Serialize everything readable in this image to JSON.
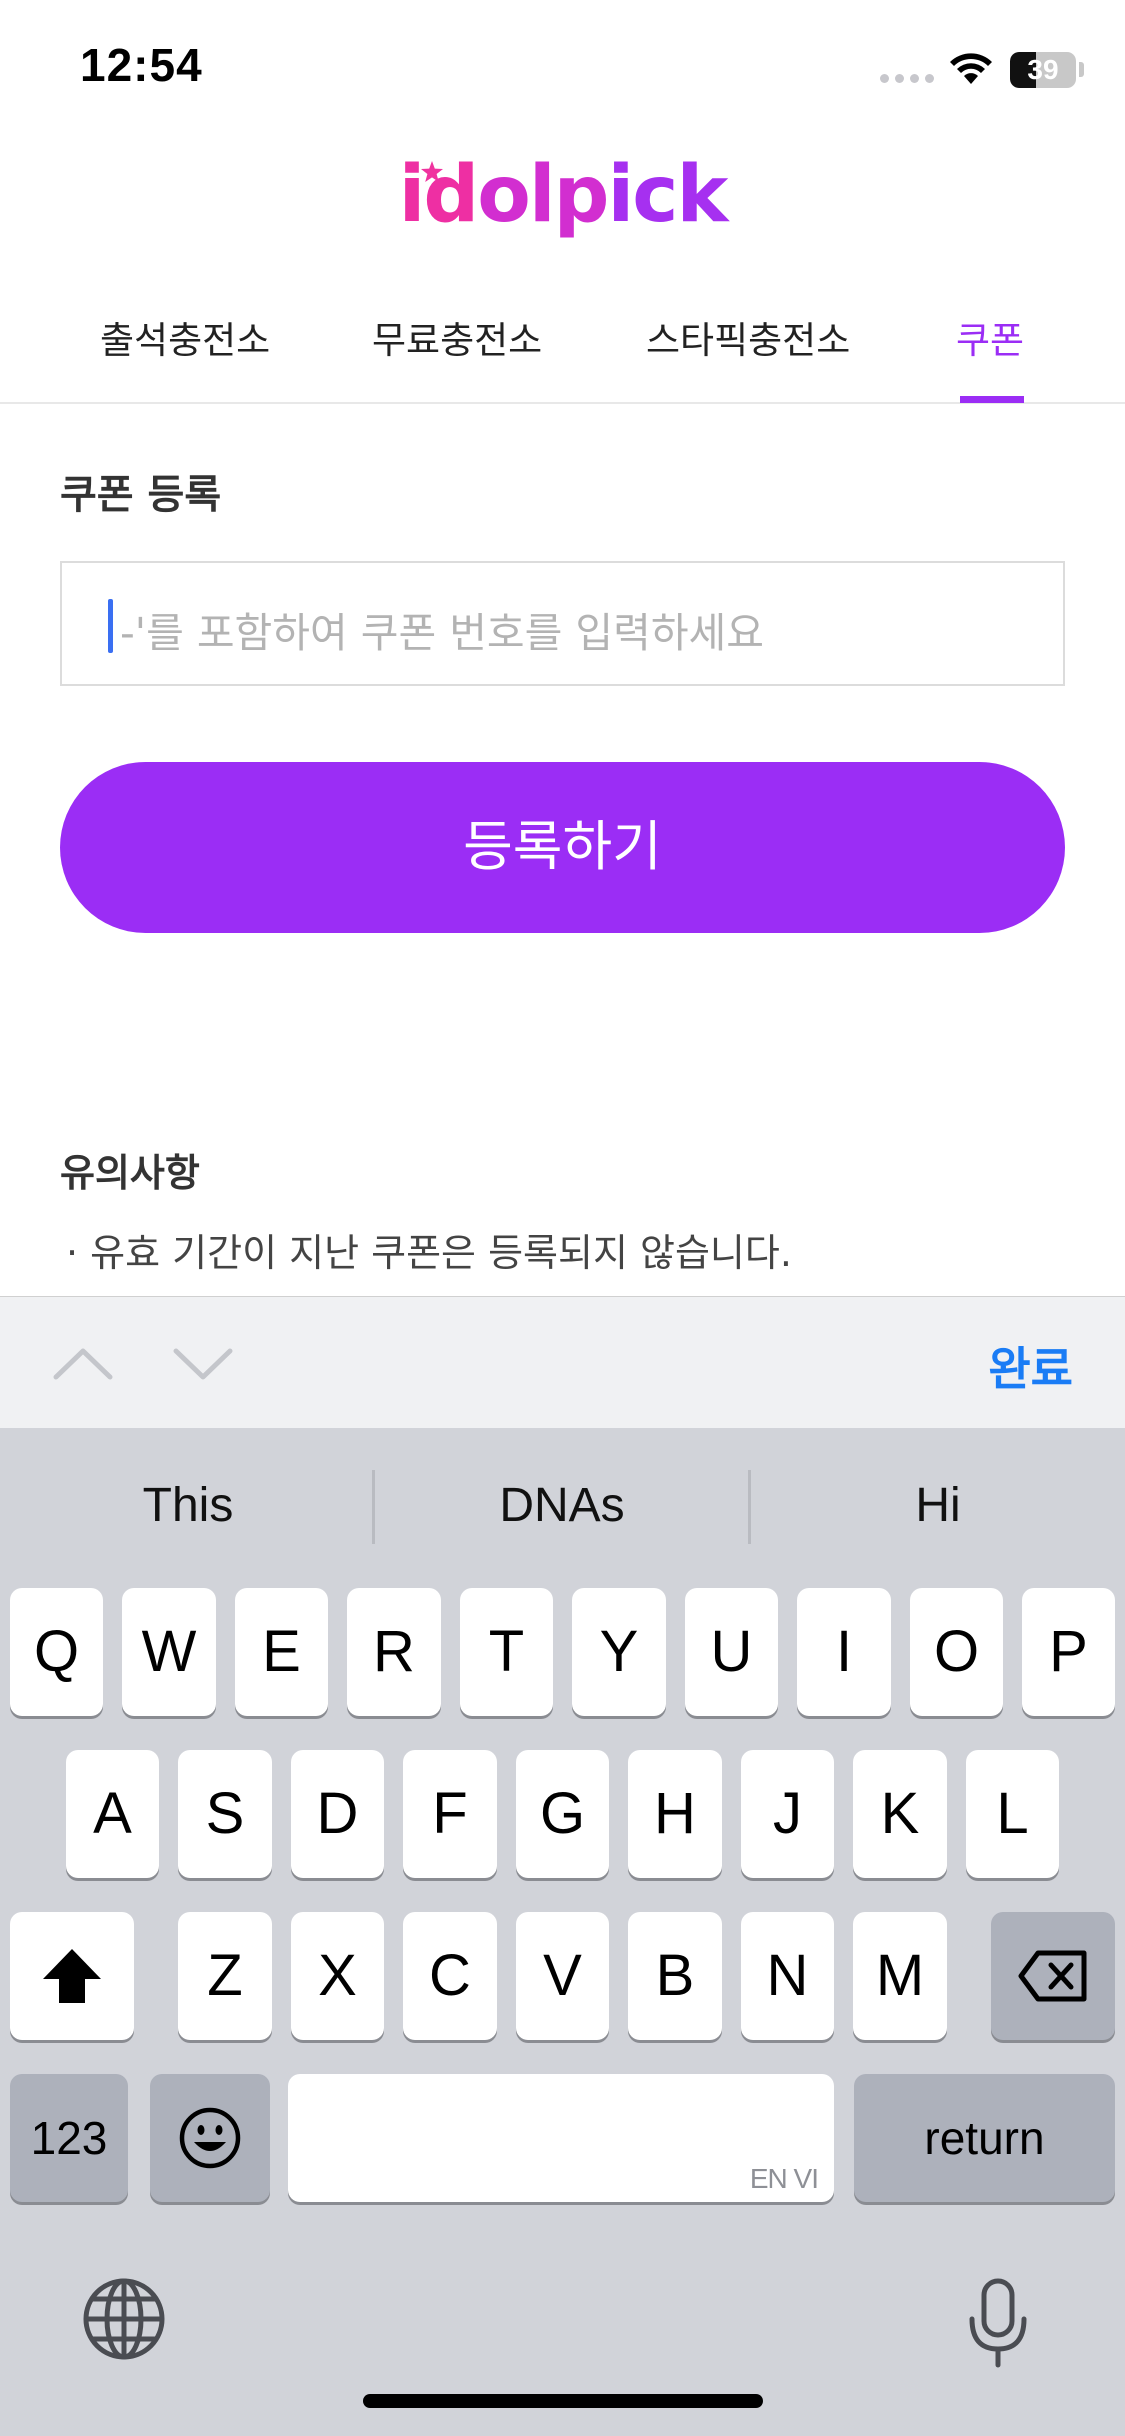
{
  "status_bar": {
    "time": "12:54",
    "battery_level": "39",
    "battery_fraction": 0.39
  },
  "logo": {
    "text": "idolpick"
  },
  "tabs": [
    {
      "label": "출석충전소",
      "active": false
    },
    {
      "label": "무료충전소",
      "active": false
    },
    {
      "label": "스타픽충전소",
      "active": false
    },
    {
      "label": "쿠폰",
      "active": true
    }
  ],
  "coupon": {
    "section_title": "쿠폰 등록",
    "input_placeholder": "-'를 포함하여 쿠폰 번호를 입력하세요",
    "input_value": "",
    "register_label": "등록하기"
  },
  "notice": {
    "title": "유의사항",
    "items": [
      "· 유효 기간이 지난 쿠폰은 등록되지 않습니다."
    ]
  },
  "accessory": {
    "prev_icon": "chevron-up-icon",
    "next_icon": "chevron-down-icon",
    "done_label": "완료"
  },
  "keyboard": {
    "suggestions": [
      "This",
      "DNAs",
      "Hi"
    ],
    "row1": [
      "Q",
      "W",
      "E",
      "R",
      "T",
      "Y",
      "U",
      "I",
      "O",
      "P"
    ],
    "row2": [
      "A",
      "S",
      "D",
      "F",
      "G",
      "H",
      "J",
      "K",
      "L"
    ],
    "row3": [
      "Z",
      "X",
      "C",
      "V",
      "B",
      "N",
      "M"
    ],
    "numbers_label": "123",
    "emoji_icon": "emoji-icon",
    "space_hint": "EN VI",
    "return_label": "return",
    "shift_icon": "shift-icon",
    "delete_icon": "delete-icon",
    "globe_icon": "globe-icon",
    "mic_icon": "microphone-icon"
  },
  "colors": {
    "accent": "#9b2df5",
    "link": "#1a7cf5",
    "keyboard_bg": "#d1d3d9"
  }
}
